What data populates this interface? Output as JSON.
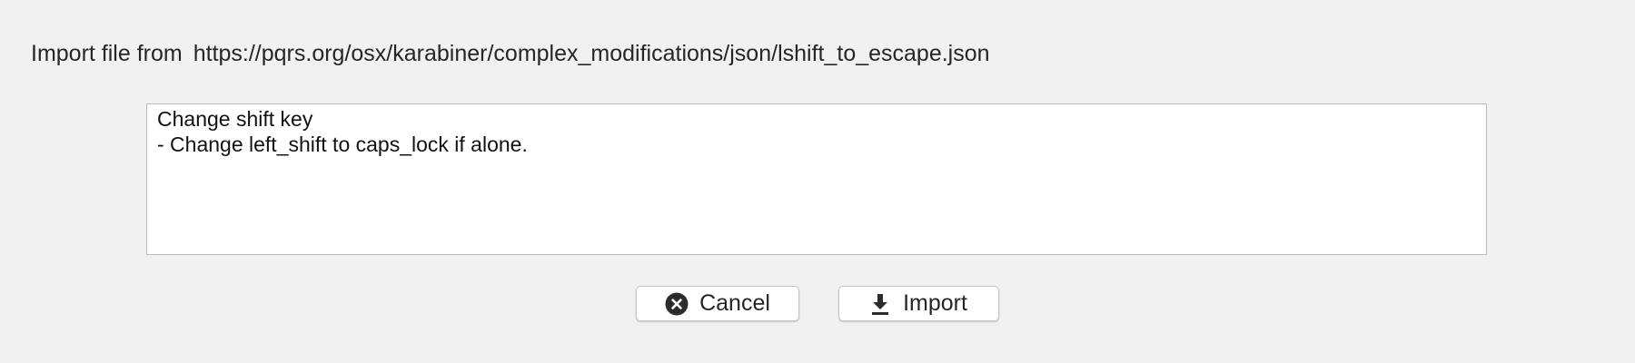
{
  "header": {
    "label": "Import file from",
    "url": "https://pqrs.org/osx/karabiner/complex_modifications/json/lshift_to_escape.json"
  },
  "description": {
    "lines": [
      "Change shift key",
      "- Change left_shift to caps_lock if alone."
    ]
  },
  "buttons": {
    "cancel": {
      "label": "Cancel",
      "icon": "close-circle-icon"
    },
    "import": {
      "label": "Import",
      "icon": "download-icon"
    }
  }
}
